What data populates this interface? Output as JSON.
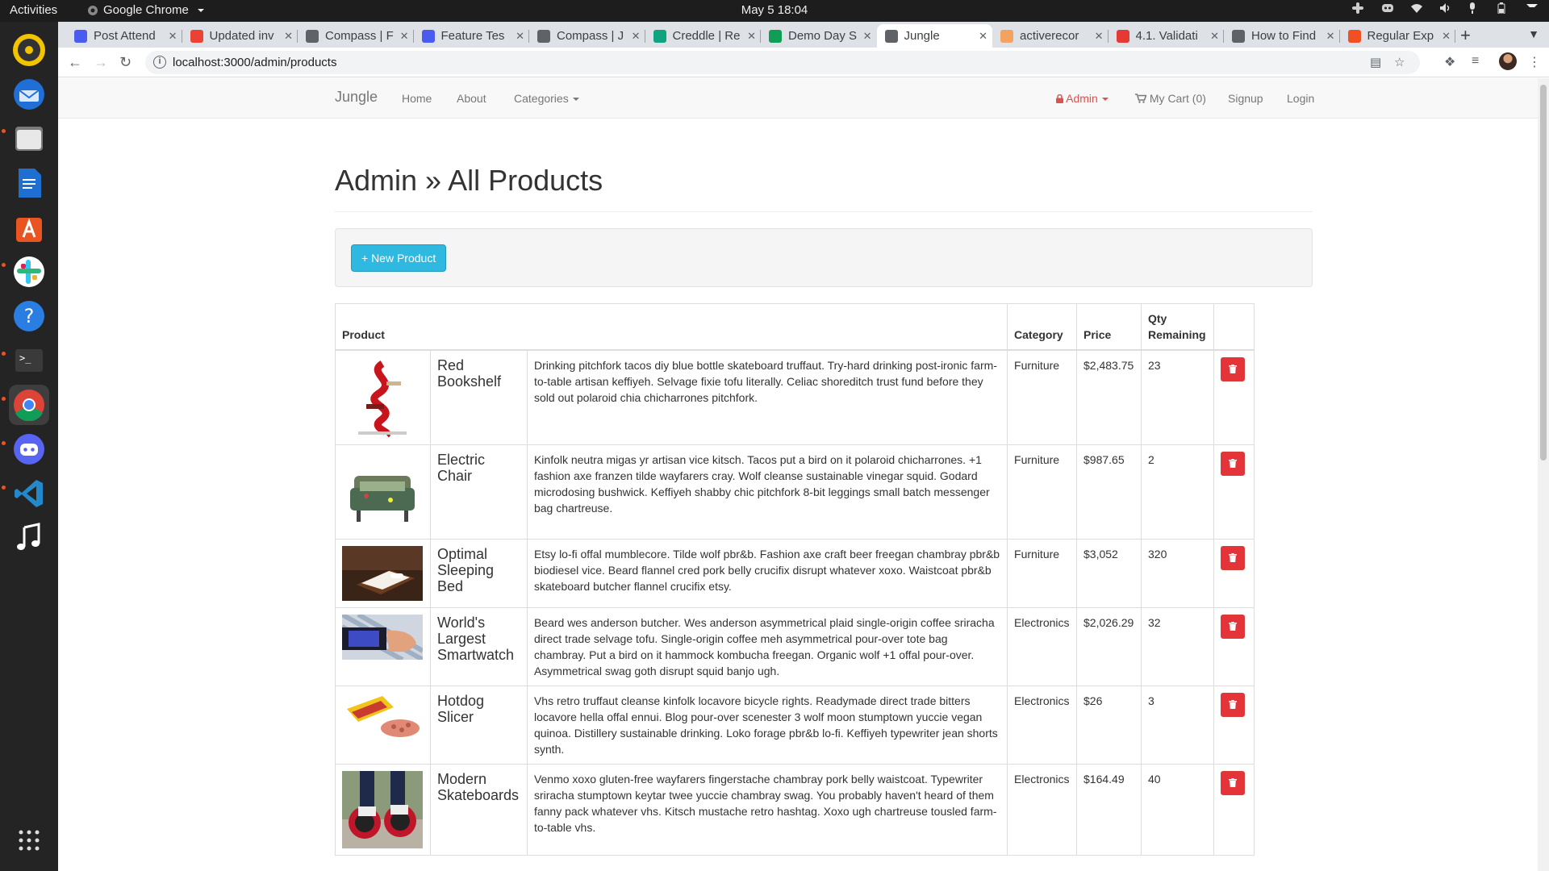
{
  "topbar": {
    "activities": "Activities",
    "app_name": "Google Chrome",
    "clock": "May 5  18:04"
  },
  "browser": {
    "tabs": [
      {
        "title": "Post Attend",
        "color": "#4a5cf0"
      },
      {
        "title": "Updated inv",
        "color": "#ea4335"
      },
      {
        "title": "Compass | F",
        "color": "#5f6368"
      },
      {
        "title": "Feature Tes",
        "color": "#4a5cf0"
      },
      {
        "title": "Compass | J",
        "color": "#5f6368"
      },
      {
        "title": "Creddle | Re",
        "color": "#10a37f"
      },
      {
        "title": "Demo Day S",
        "color": "#0f9d58"
      },
      {
        "title": "Jungle",
        "color": "#5f6368"
      },
      {
        "title": "activerecor",
        "color": "#f4a261"
      },
      {
        "title": "4.1. Validati",
        "color": "#e53935"
      },
      {
        "title": "How to Find",
        "color": "#5f6368"
      },
      {
        "title": "Regular Exp",
        "color": "#f25022"
      }
    ],
    "url": "localhost:3000/admin/products"
  },
  "site": {
    "brand": "Jungle",
    "nav": {
      "home": "Home",
      "about": "About",
      "categories": "Categories",
      "admin": "Admin",
      "cart": "My Cart (0)",
      "signup": "Signup",
      "login": "Login"
    },
    "page_title": "Admin » All Products",
    "new_product_label": "+ New Product",
    "table": {
      "headers": {
        "product": "Product",
        "category": "Category",
        "price": "Price",
        "qty": "Qty Remaining"
      },
      "rows": [
        {
          "name": "Red Bookshelf",
          "description": "Drinking pitchfork tacos diy blue bottle skateboard truffaut. Try-hard drinking post-ironic farm-to-table artisan keffiyeh. Selvage fixie tofu literally. Celiac shoreditch trust fund before they sold out polaroid chia chicharrones pitchfork.",
          "category": "Furniture",
          "price": "$2,483.75",
          "qty": "23"
        },
        {
          "name": "Electric Chair",
          "description": "Kinfolk neutra migas yr artisan vice kitsch. Tacos put a bird on it polaroid chicharrones. +1 fashion axe franzen tilde wayfarers cray. Wolf cleanse sustainable vinegar squid. Godard microdosing bushwick. Keffiyeh shabby chic pitchfork 8-bit leggings small batch messenger bag chartreuse.",
          "category": "Furniture",
          "price": "$987.65",
          "qty": "2"
        },
        {
          "name": "Optimal Sleeping Bed",
          "description": "Etsy lo-fi offal mumblecore. Tilde wolf pbr&b. Fashion axe craft beer freegan chambray pbr&b biodiesel vice. Beard flannel cred pork belly crucifix disrupt whatever xoxo. Waistcoat pbr&b skateboard butcher flannel crucifix etsy.",
          "category": "Furniture",
          "price": "$3,052",
          "qty": "320"
        },
        {
          "name": "World's Largest Smartwatch",
          "description": "Beard wes anderson butcher. Wes anderson asymmetrical plaid single-origin coffee sriracha direct trade selvage tofu. Single-origin coffee meh asymmetrical pour-over tote bag chambray. Put a bird on it hammock kombucha freegan. Organic wolf +1 offal pour-over. Asymmetrical swag goth disrupt squid banjo ugh.",
          "category": "Electronics",
          "price": "$2,026.29",
          "qty": "32"
        },
        {
          "name": "Hotdog Slicer",
          "description": "Vhs retro truffaut cleanse kinfolk locavore bicycle rights. Readymade direct trade bitters locavore hella offal ennui. Blog pour-over scenester 3 wolf moon stumptown yuccie vegan quinoa. Distillery sustainable drinking. Loko forage pbr&b lo-fi. Keffiyeh typewriter jean shorts synth.",
          "category": "Electronics",
          "price": "$26",
          "qty": "3"
        },
        {
          "name": "Modern Skateboards",
          "description": "Venmo xoxo gluten-free wayfarers fingerstache chambray pork belly waistcoat. Typewriter sriracha stumptown keytar twee yuccie chambray swag. You probably haven't heard of them fanny pack whatever vhs. Kitsch mustache retro hashtag. Xoxo ugh chartreuse tousled farm-to-table vhs.",
          "category": "Electronics",
          "price": "$164.49",
          "qty": "40"
        }
      ]
    }
  }
}
